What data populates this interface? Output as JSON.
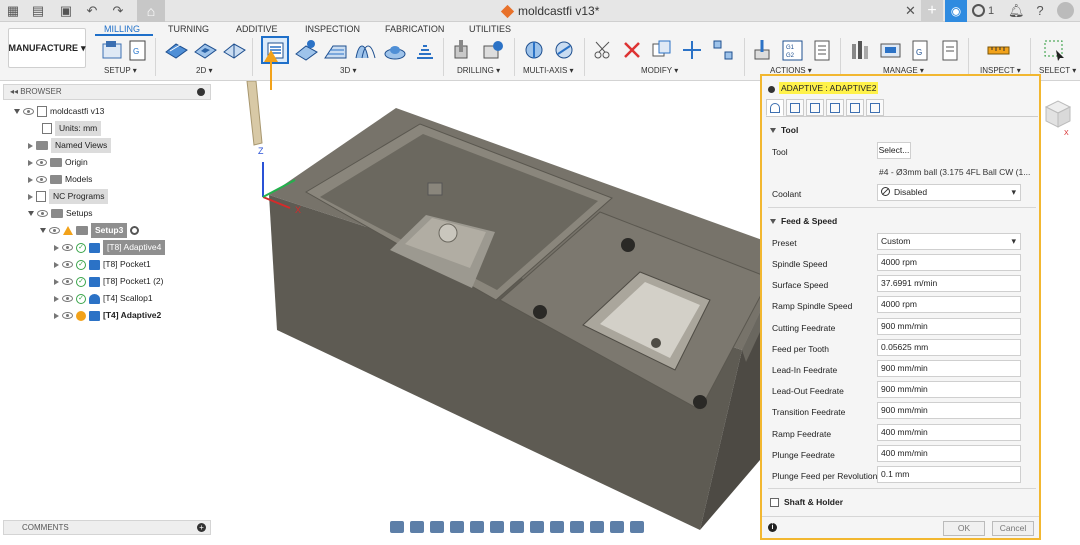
{
  "titlebar": {
    "document_title": "moldcastfi v13*",
    "job_count": "1",
    "icons": [
      "grid-icon",
      "file-icon",
      "save-icon",
      "undo-icon",
      "redo-icon",
      "home-icon",
      "close-icon",
      "plus-icon",
      "online-icon",
      "clock-icon",
      "help-icon",
      "bell-icon",
      "avatar"
    ]
  },
  "ribbon": {
    "workspace_label": "MANUFACTURE",
    "tabs": [
      "MILLING",
      "TURNING",
      "ADDITIVE",
      "INSPECTION",
      "FABRICATION",
      "UTILITIES"
    ],
    "active_tab": "MILLING",
    "groups": [
      "SETUP ▾",
      "2D ▾",
      "3D ▾",
      "DRILLING ▾",
      "MULTI-AXIS ▾",
      "MODIFY ▾",
      "ACTIONS ▾",
      "MANAGE ▾",
      "INSPECT ▾",
      "SELECT ▾"
    ]
  },
  "browser": {
    "header": "BROWSER",
    "items": [
      {
        "label": "moldcastfi v13"
      },
      {
        "label": "Units: mm"
      },
      {
        "label": "Named Views"
      },
      {
        "label": "Origin"
      },
      {
        "label": "Models"
      },
      {
        "label": "NC Programs"
      },
      {
        "label": "Setups"
      },
      {
        "label": "Setup3"
      },
      {
        "label": "[T8] Adaptive4"
      },
      {
        "label": "[T8] Pocket1"
      },
      {
        "label": "[T8] Pocket1 (2)"
      },
      {
        "label": "[T4] Scallop1"
      },
      {
        "label": "[T4] Adaptive2"
      }
    ]
  },
  "comments": {
    "label": "COMMENTS"
  },
  "viewport": {
    "axis_z": "Z",
    "axis_x": "X"
  },
  "dialog": {
    "title": "ADAPTIVE : ADAPTIVE2",
    "sections": {
      "tool": "Tool",
      "feed_speed": "Feed & Speed",
      "shaft_holder": "Shaft & Holder"
    },
    "tool": {
      "label": "Tool",
      "select_button": "Select...",
      "description": "#4 - Ø3mm ball (3.175 4FL Ball CW  (1..."
    },
    "coolant": {
      "label": "Coolant",
      "value": "Disabled"
    },
    "preset": {
      "label": "Preset",
      "value": "Custom"
    },
    "fields": [
      {
        "label": "Spindle Speed",
        "value": "4000 rpm"
      },
      {
        "label": "Surface Speed",
        "value": "37.6991 m/min"
      },
      {
        "label": "Ramp Spindle Speed",
        "value": "4000 rpm"
      },
      {
        "label": "Cutting Feedrate",
        "value": "900 mm/min"
      },
      {
        "label": "Feed per Tooth",
        "value": "0.05625 mm"
      },
      {
        "label": "Lead-In Feedrate",
        "value": "900 mm/min"
      },
      {
        "label": "Lead-Out Feedrate",
        "value": "900 mm/min"
      },
      {
        "label": "Transition Feedrate",
        "value": "900 mm/min"
      },
      {
        "label": "Ramp Feedrate",
        "value": "400 mm/min"
      },
      {
        "label": "Plunge Feedrate",
        "value": "400 mm/min"
      },
      {
        "label": "Plunge Feed per Revolution",
        "value": "0.1 mm"
      }
    ],
    "ok": "OK",
    "cancel": "Cancel"
  },
  "colors": {
    "accent_blue": "#1e6fc9",
    "highlight_orange": "#f2b730",
    "title_highlight": "#fff24a",
    "part_gray": "#6e6b63"
  }
}
